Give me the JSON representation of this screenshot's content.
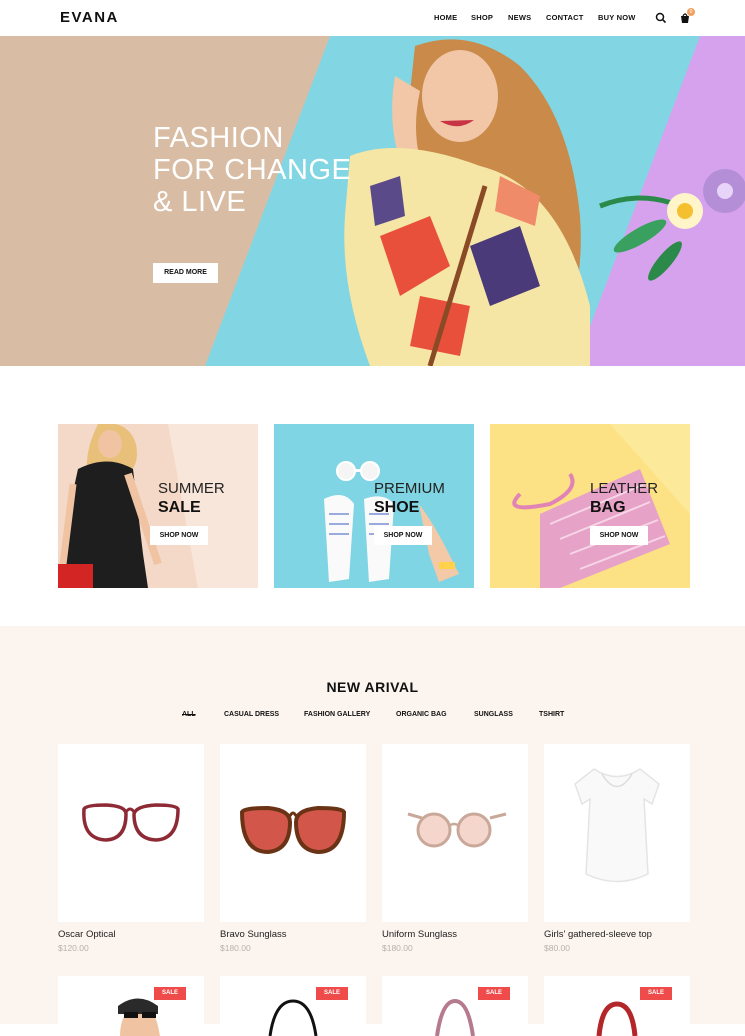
{
  "brand": {
    "name": "EVANA"
  },
  "nav": {
    "items": [
      {
        "label": "HOME"
      },
      {
        "label": "SHOP"
      },
      {
        "label": "NEWS"
      },
      {
        "label": "CONTACT"
      },
      {
        "label": "BUY NOW"
      }
    ],
    "search_icon": "search-icon",
    "cart_icon": "cart-icon",
    "cart_count": "0"
  },
  "hero": {
    "line1": "FASHION",
    "line2": "FOR CHANGE",
    "line3_prefix": "& ",
    "line3_bold": "LIVE",
    "button": "READ MORE"
  },
  "promos": [
    {
      "line1": "SUMMER",
      "line2": "SALE",
      "button": "SHOP NOW",
      "bg": "#f5d9c8"
    },
    {
      "line1": "PREMIUM",
      "line2": "SHOE",
      "button": "SHOP NOW",
      "bg": "#7fd5e4"
    },
    {
      "line1": "LEATHER",
      "line2": "BAG",
      "button": "SHOP NOW",
      "bg": "#fde99a"
    }
  ],
  "new_arrival": {
    "title": "NEW ARIVAL",
    "filters": [
      {
        "label": "ALL"
      },
      {
        "label": "CASUAL DRESS"
      },
      {
        "label": "FASHION GALLERY"
      },
      {
        "label": "ORGANIC BAG"
      },
      {
        "label": "SUNGLASS"
      },
      {
        "label": "TSHIRT"
      }
    ],
    "products": [
      {
        "name": "Oscar Optical",
        "price": "$120.00"
      },
      {
        "name": "Bravo Sunglass",
        "price": "$180.00"
      },
      {
        "name": "Uniform Sunglass",
        "price": "$180.00"
      },
      {
        "name": "Girls' gathered-sleeve top",
        "price": "$80.00"
      }
    ],
    "sale_badge": "SALE"
  },
  "colors": {
    "accent": "#f04b4b",
    "section_bg": "#fcf4ee",
    "hero_tan": "#d9bca4",
    "hero_cyan": "#7fd5e4",
    "hero_purple": "#d6a2ee"
  }
}
